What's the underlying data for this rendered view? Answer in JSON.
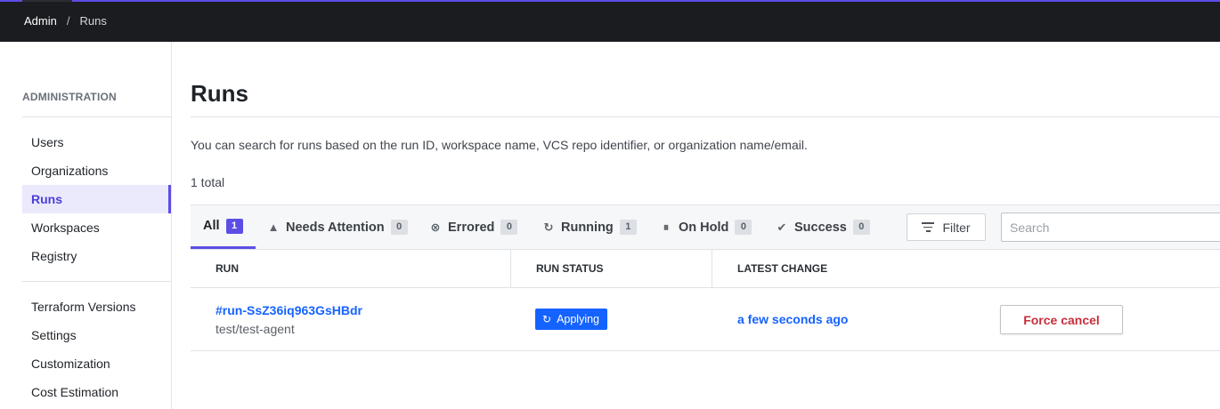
{
  "breadcrumb": {
    "root": "Admin",
    "separator": "/",
    "current": "Runs"
  },
  "sidebar": {
    "heading": "ADMINISTRATION",
    "groups": [
      [
        "Users",
        "Organizations",
        "Runs",
        "Workspaces",
        "Registry"
      ],
      [
        "Terraform Versions",
        "Settings",
        "Customization",
        "Cost Estimation"
      ]
    ],
    "active": "Runs"
  },
  "page": {
    "title": "Runs",
    "description": "You can search for runs based on the run ID, workspace name, VCS repo identifier, or organization name/email.",
    "total": "1 total"
  },
  "tabs": [
    {
      "label": "All",
      "count": "1",
      "icon": "none",
      "active": true
    },
    {
      "label": "Needs Attention",
      "count": "0",
      "icon": "warning-icon"
    },
    {
      "label": "Errored",
      "count": "0",
      "icon": "error-circle-icon"
    },
    {
      "label": "Running",
      "count": "1",
      "icon": "sync-icon"
    },
    {
      "label": "On Hold",
      "count": "0",
      "icon": "pause-circle-icon"
    },
    {
      "label": "Success",
      "count": "0",
      "icon": "check-circle-icon"
    }
  ],
  "toolbar": {
    "filter_label": "Filter",
    "search_placeholder": "Search"
  },
  "table": {
    "columns": [
      "RUN",
      "RUN STATUS",
      "LATEST CHANGE"
    ],
    "rows": [
      {
        "run_id": "#run-SsZ36iq963GsHBdr",
        "workspace": "test/test-agent",
        "status": "Applying",
        "latest_change": "a few seconds ago",
        "action": "Force cancel"
      }
    ]
  },
  "colors": {
    "accent": "#5c4ee5",
    "link": "#1563ff",
    "danger": "#c72e3c",
    "topbar": "#1b1c20"
  }
}
